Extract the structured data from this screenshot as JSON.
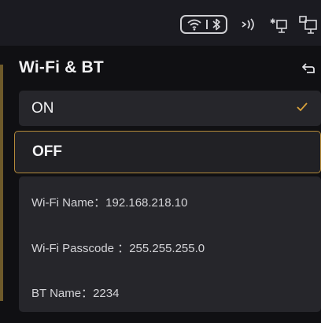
{
  "header": {
    "title": "Wi-Fi & BT"
  },
  "options": [
    {
      "label": "ON",
      "selected": true
    },
    {
      "label": "OFF",
      "selected": false,
      "focused": true
    }
  ],
  "info": {
    "wifi_name_label": "Wi-Fi Name：",
    "wifi_name_value": "192.168.218.10",
    "wifi_passcode_label": "Wi-Fi Passcode ：",
    "wifi_passcode_value": "255.255.255.0",
    "bt_name_label": "BT Name：",
    "bt_name_value": "2234"
  },
  "status_icons": [
    "wifi-icon",
    "bluetooth-icon",
    "nfc-icon",
    "usb-device-icon",
    "network-icon"
  ],
  "back_icon": "back-arrow-icon",
  "colors": {
    "accent": "#d9a23c",
    "focus_border": "#b48a3a",
    "background": "#101013",
    "card": "#26262b"
  }
}
